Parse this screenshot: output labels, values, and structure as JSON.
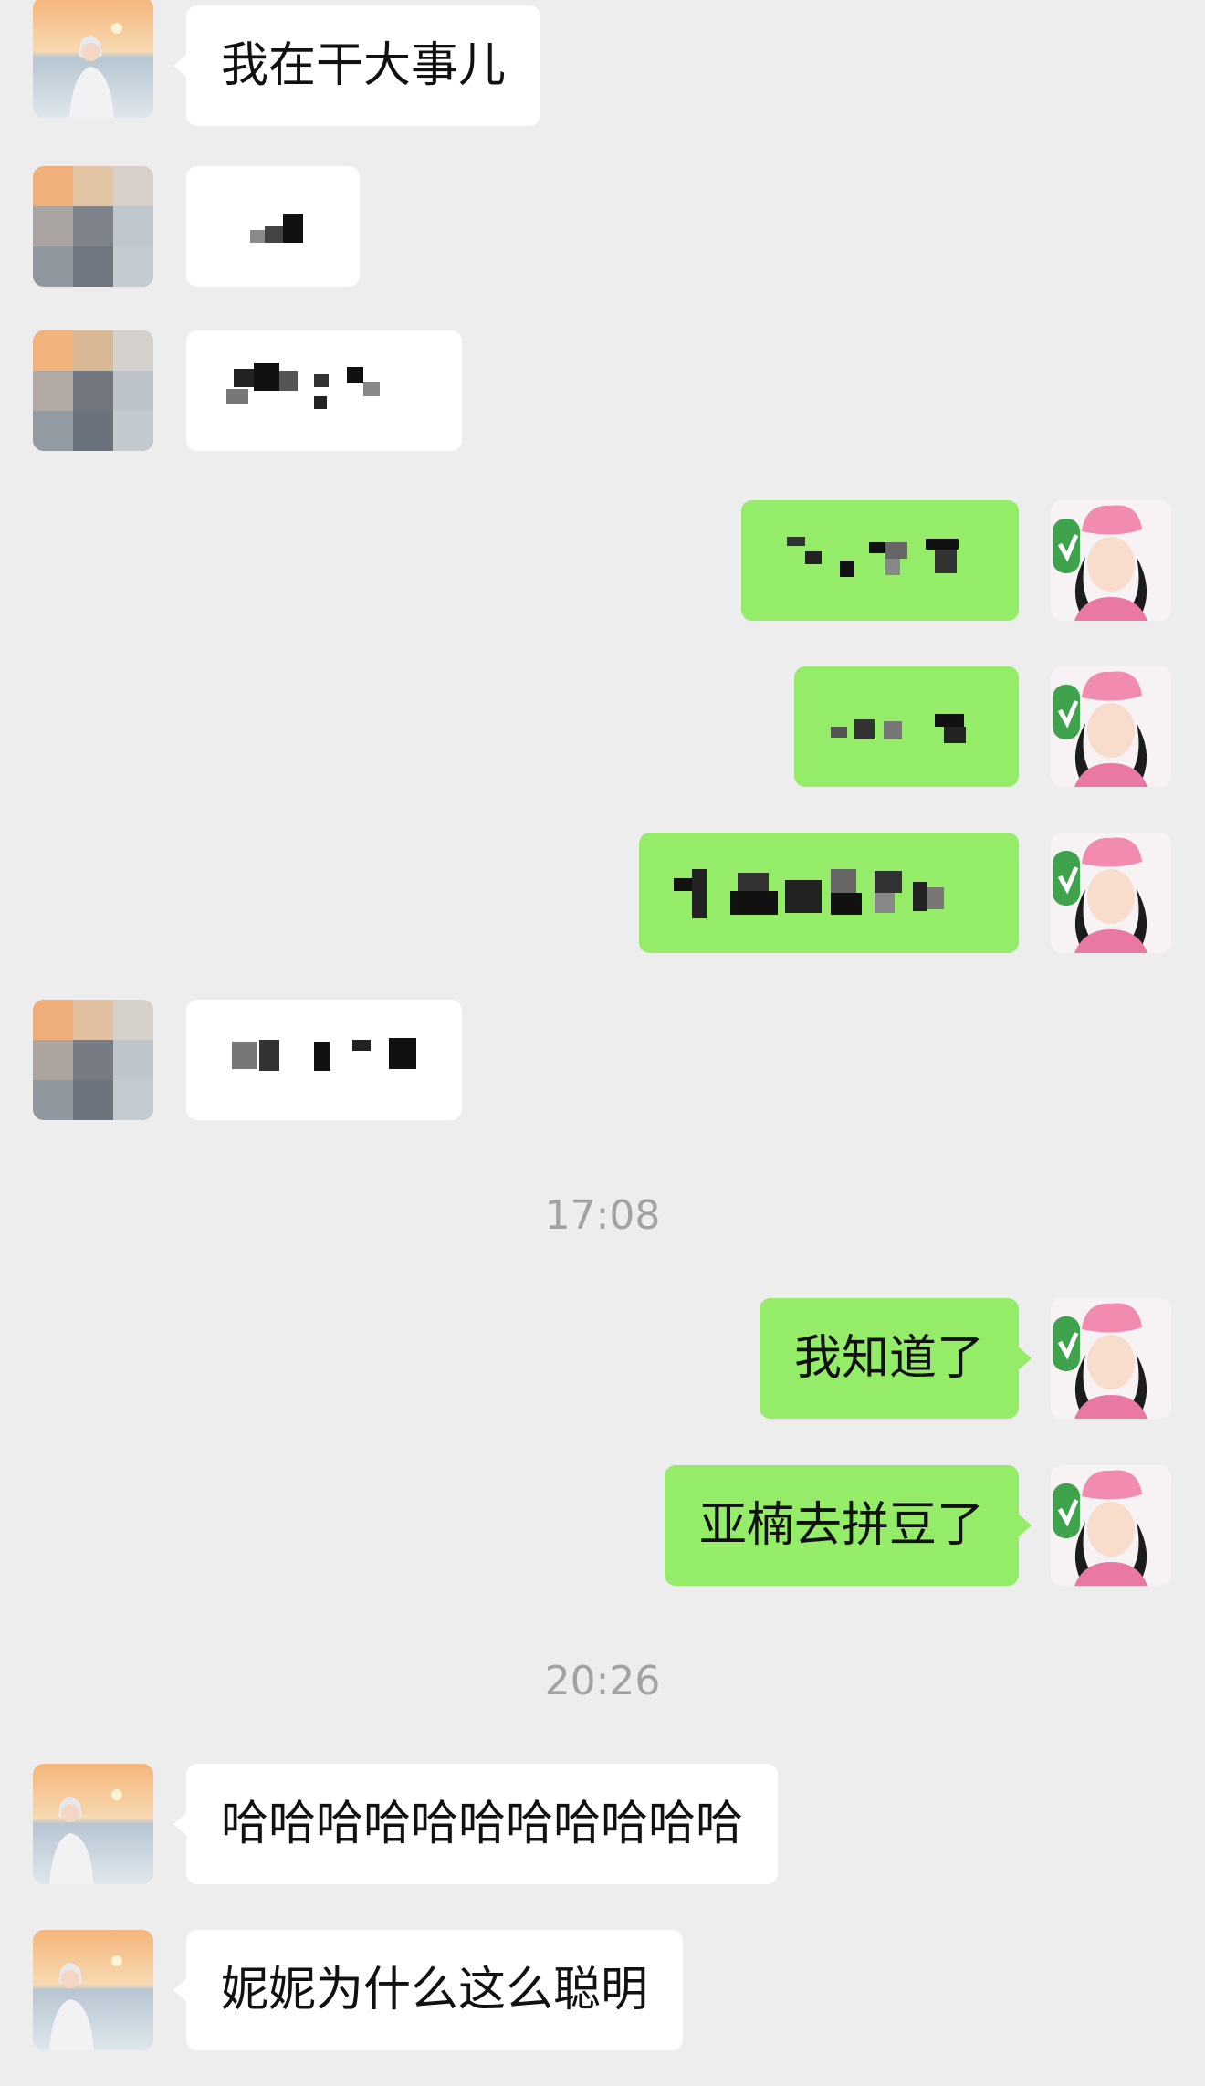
{
  "conversation": {
    "messages": [
      {
        "side": "in",
        "text": "我在干大事儿"
      },
      {
        "side": "in",
        "text": ""
      },
      {
        "side": "in",
        "text": ""
      },
      {
        "side": "out",
        "text": ""
      },
      {
        "side": "out",
        "text": ""
      },
      {
        "side": "out",
        "text": ""
      },
      {
        "side": "in",
        "text": ""
      },
      {
        "side": "out",
        "text": "我知道了"
      },
      {
        "side": "out",
        "text": "亚楠去拼豆了"
      },
      {
        "side": "in",
        "text": "哈哈哈哈哈哈哈哈哈哈哈"
      },
      {
        "side": "in",
        "text": "妮妮为什么这么聪明"
      }
    ],
    "timestamps": [
      "17:08",
      "20:26"
    ]
  },
  "avatars": {
    "contact": "contact-avatar",
    "self": "self-avatar"
  },
  "colors": {
    "background": "#ededed",
    "incoming_bubble": "#ffffff",
    "outgoing_bubble": "#95ec69",
    "timestamp_text": "#a2a2a2"
  }
}
